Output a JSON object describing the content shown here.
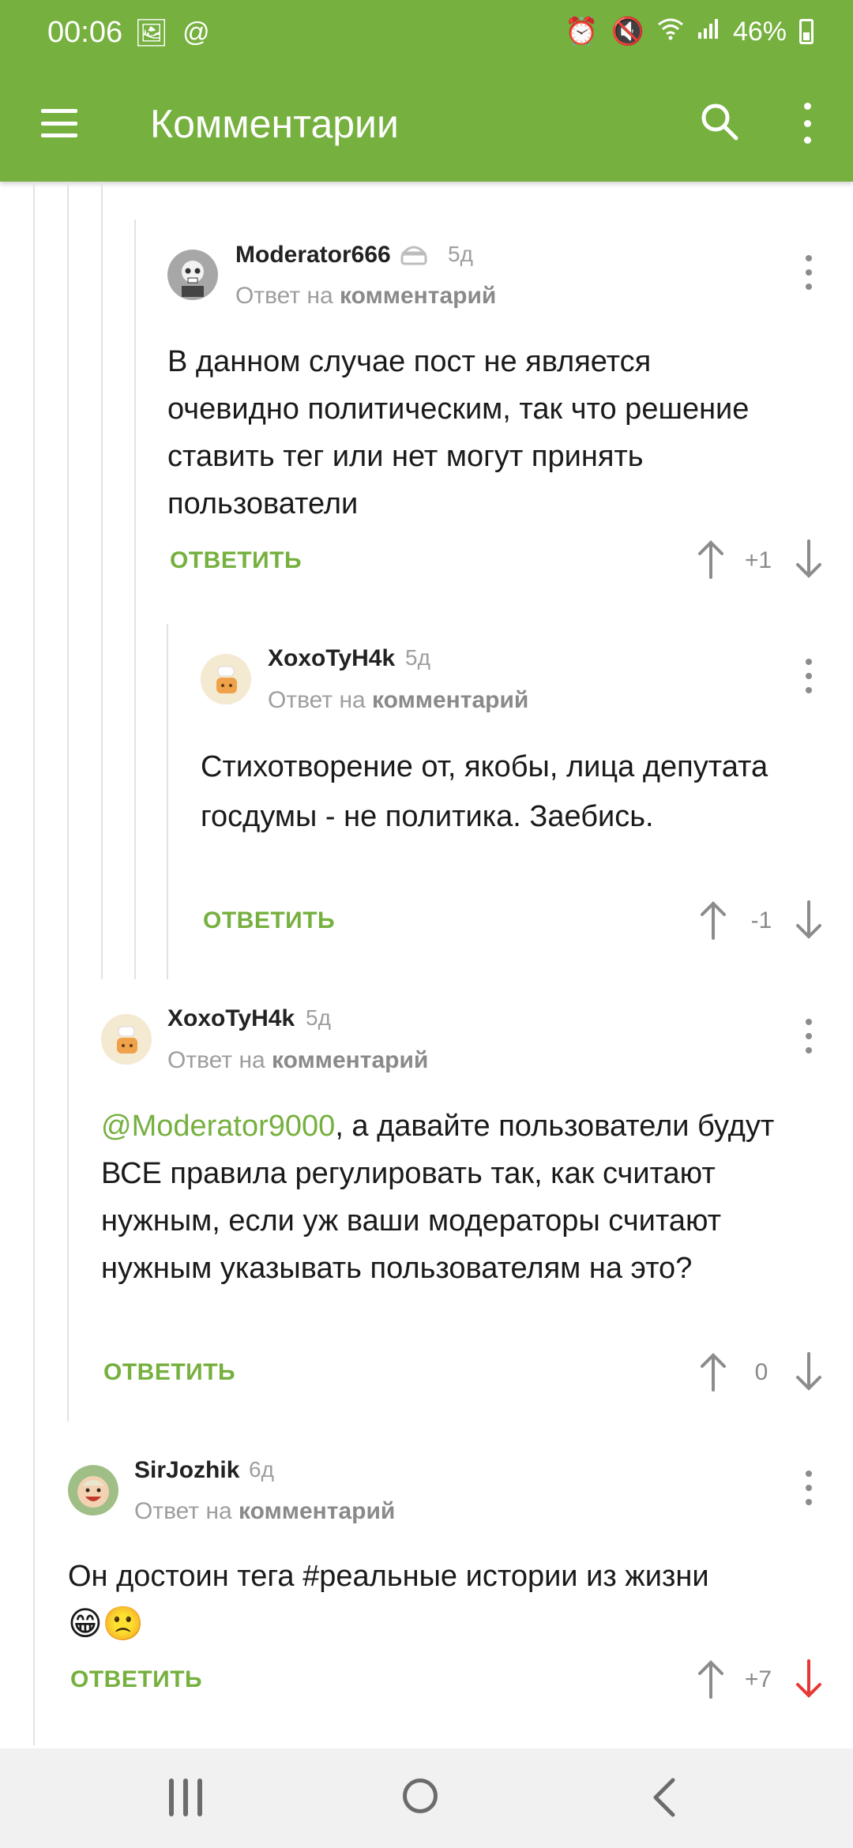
{
  "status_bar": {
    "time": "00:06",
    "battery": "46%"
  },
  "appbar": {
    "title": "Комментарии"
  },
  "comments": [
    {
      "author": "Moderator666",
      "age": "5д",
      "reply_prefix": "Ответ на",
      "reply_target": "комментарий",
      "text": "В данном случае пост не является очевидно политическим, так что решение ставить тег или нет могут принять пользователи",
      "reply_label": "ОТВЕТИТЬ",
      "score": "+1"
    },
    {
      "author": "XoxoTyH4k",
      "age": "5д",
      "reply_prefix": "Ответ на",
      "reply_target": "комментарий",
      "text": "Стихотворение от, якобы, лица депутата госдумы - не политика. Заебись.",
      "reply_label": "ОТВЕТИТЬ",
      "score": "-1"
    },
    {
      "author": "XoxoTyH4k",
      "age": "5д",
      "reply_prefix": "Ответ на",
      "reply_target": "комментарий",
      "mention": "@Moderator9000",
      "text": ", а давайте пользователи будут ВСЕ правила регулировать так, как считают нужным, если уж ваши модераторы считают нужным указывать пользователям на это?",
      "reply_label": "ОТВЕТИТЬ",
      "score": "0"
    },
    {
      "author": "SirJozhik",
      "age": "6д",
      "reply_prefix": "Ответ на",
      "reply_target": "комментарий",
      "text": "Он достоин тега #реальные истории из жизни",
      "emojis": "😁🙁",
      "reply_label": "ОТВЕТИТЬ",
      "score": "+7"
    }
  ],
  "colors": {
    "brand": "#76b03f",
    "downvote_active": "#e53935"
  }
}
